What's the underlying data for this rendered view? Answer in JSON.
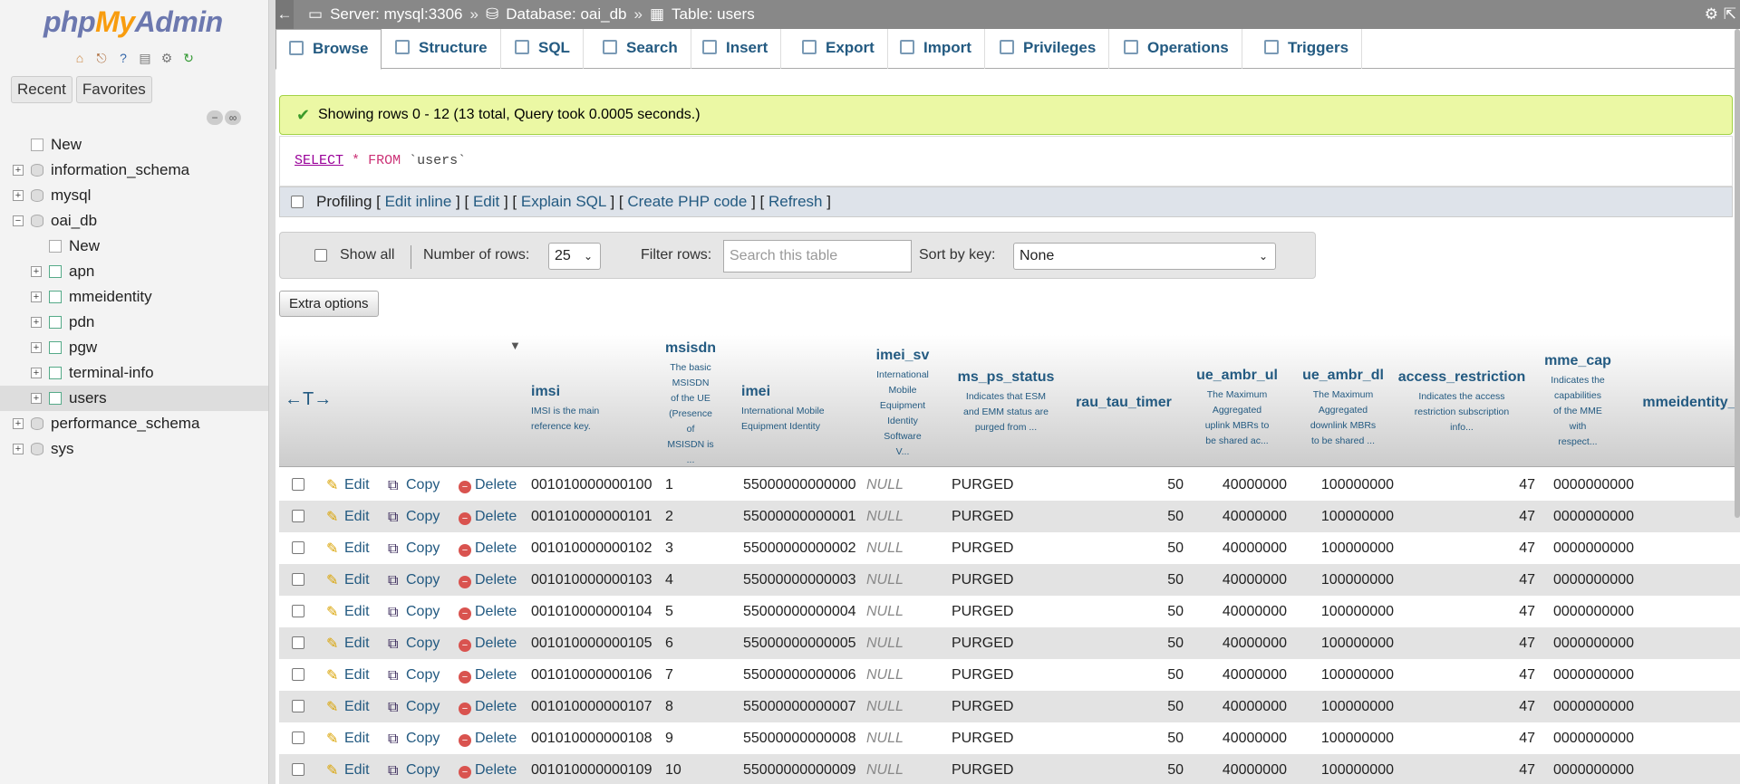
{
  "app": {
    "logo_left": "php",
    "logo_mid": "My",
    "logo_right": "Admin"
  },
  "sidebar": {
    "tabs": [
      "Recent",
      "Favorites"
    ],
    "tree": [
      {
        "label": "New",
        "level": 0,
        "kind": "new"
      },
      {
        "label": "information_schema",
        "level": 0,
        "kind": "db"
      },
      {
        "label": "mysql",
        "level": 0,
        "kind": "db"
      },
      {
        "label": "oai_db",
        "level": 0,
        "kind": "db",
        "expanded": true
      },
      {
        "label": "New",
        "level": 1,
        "kind": "new"
      },
      {
        "label": "apn",
        "level": 1,
        "kind": "tbl"
      },
      {
        "label": "mmeidentity",
        "level": 1,
        "kind": "tbl"
      },
      {
        "label": "pdn",
        "level": 1,
        "kind": "tbl"
      },
      {
        "label": "pgw",
        "level": 1,
        "kind": "tbl"
      },
      {
        "label": "terminal-info",
        "level": 1,
        "kind": "tbl"
      },
      {
        "label": "users",
        "level": 1,
        "kind": "tbl",
        "selected": true
      },
      {
        "label": "performance_schema",
        "level": 0,
        "kind": "db"
      },
      {
        "label": "sys",
        "level": 0,
        "kind": "db"
      }
    ]
  },
  "breadcrumb": {
    "server": "Server: mysql:3306",
    "database": "Database: oai_db",
    "table": "Table: users",
    "sep": "»"
  },
  "tabs": [
    {
      "label": "Browse",
      "active": true
    },
    {
      "label": "Structure"
    },
    {
      "label": "SQL"
    },
    {
      "label": "Search"
    },
    {
      "label": "Insert"
    },
    {
      "label": "Export"
    },
    {
      "label": "Import"
    },
    {
      "label": "Privileges"
    },
    {
      "label": "Operations"
    },
    {
      "label": "Triggers"
    }
  ],
  "success_message": "Showing rows 0 - 12 (13 total, Query took 0.0005 seconds.)",
  "sql": {
    "kw": "SELECT",
    "star": "*",
    "from": "FROM",
    "table": "`users`"
  },
  "profiling": {
    "label": "Profiling",
    "links": [
      "Edit inline",
      "Edit",
      "Explain SQL",
      "Create PHP code",
      "Refresh"
    ]
  },
  "navbar": {
    "show_all": "Show all",
    "rows_label": "Number of rows:",
    "rows_value": "25",
    "filter_label": "Filter rows:",
    "filter_placeholder": "Search this table",
    "sort_label": "Sort by key:",
    "sort_value": "None"
  },
  "extra_options": "Extra options",
  "columns": [
    {
      "name": "imsi",
      "desc": [
        "IMSI is the main",
        "reference key."
      ]
    },
    {
      "name": "msisdn",
      "desc": [
        "The basic",
        "MSISDN",
        "of the UE",
        "(Presence",
        "of",
        "MSISDN is",
        "..."
      ]
    },
    {
      "name": "imei",
      "desc": [
        "International Mobile",
        "Equipment Identity"
      ]
    },
    {
      "name": "imei_sv",
      "desc": [
        "International",
        "Mobile",
        "Equipment",
        "Identity",
        "Software",
        "V..."
      ]
    },
    {
      "name": "ms_ps_status",
      "desc": [
        "Indicates that ESM",
        "and EMM status are",
        "purged from ..."
      ]
    },
    {
      "name": "rau_tau_timer",
      "desc": []
    },
    {
      "name": "ue_ambr_ul",
      "desc": [
        "The Maximum",
        "Aggregated",
        "uplink MBRs to",
        "be shared ac..."
      ]
    },
    {
      "name": "ue_ambr_dl",
      "desc": [
        "The Maximum",
        "Aggregated",
        "downlink MBRs",
        "to be shared ..."
      ]
    },
    {
      "name": "access_restriction",
      "desc": [
        "Indicates the access",
        "restriction subscription",
        "info..."
      ]
    },
    {
      "name": "mme_cap",
      "desc": [
        "Indicates the",
        "capabilities",
        "of the MME",
        "with",
        "respect..."
      ]
    },
    {
      "name": "mmeidentity_",
      "desc": []
    }
  ],
  "actions": {
    "edit": "Edit",
    "copy": "Copy",
    "delete": "Delete"
  },
  "rows": [
    {
      "imsi": "001010000000100",
      "msisdn": "1",
      "imei": "55000000000000",
      "imei_sv": "NULL",
      "ms_ps_status": "PURGED",
      "rau_tau_timer": "50",
      "ue_ambr_ul": "40000000",
      "ue_ambr_dl": "100000000",
      "access_restriction": "47",
      "mme_cap": "0000000000"
    },
    {
      "imsi": "001010000000101",
      "msisdn": "2",
      "imei": "55000000000001",
      "imei_sv": "NULL",
      "ms_ps_status": "PURGED",
      "rau_tau_timer": "50",
      "ue_ambr_ul": "40000000",
      "ue_ambr_dl": "100000000",
      "access_restriction": "47",
      "mme_cap": "0000000000"
    },
    {
      "imsi": "001010000000102",
      "msisdn": "3",
      "imei": "55000000000002",
      "imei_sv": "NULL",
      "ms_ps_status": "PURGED",
      "rau_tau_timer": "50",
      "ue_ambr_ul": "40000000",
      "ue_ambr_dl": "100000000",
      "access_restriction": "47",
      "mme_cap": "0000000000"
    },
    {
      "imsi": "001010000000103",
      "msisdn": "4",
      "imei": "55000000000003",
      "imei_sv": "NULL",
      "ms_ps_status": "PURGED",
      "rau_tau_timer": "50",
      "ue_ambr_ul": "40000000",
      "ue_ambr_dl": "100000000",
      "access_restriction": "47",
      "mme_cap": "0000000000"
    },
    {
      "imsi": "001010000000104",
      "msisdn": "5",
      "imei": "55000000000004",
      "imei_sv": "NULL",
      "ms_ps_status": "PURGED",
      "rau_tau_timer": "50",
      "ue_ambr_ul": "40000000",
      "ue_ambr_dl": "100000000",
      "access_restriction": "47",
      "mme_cap": "0000000000"
    },
    {
      "imsi": "001010000000105",
      "msisdn": "6",
      "imei": "55000000000005",
      "imei_sv": "NULL",
      "ms_ps_status": "PURGED",
      "rau_tau_timer": "50",
      "ue_ambr_ul": "40000000",
      "ue_ambr_dl": "100000000",
      "access_restriction": "47",
      "mme_cap": "0000000000"
    },
    {
      "imsi": "001010000000106",
      "msisdn": "7",
      "imei": "55000000000006",
      "imei_sv": "NULL",
      "ms_ps_status": "PURGED",
      "rau_tau_timer": "50",
      "ue_ambr_ul": "40000000",
      "ue_ambr_dl": "100000000",
      "access_restriction": "47",
      "mme_cap": "0000000000"
    },
    {
      "imsi": "001010000000107",
      "msisdn": "8",
      "imei": "55000000000007",
      "imei_sv": "NULL",
      "ms_ps_status": "PURGED",
      "rau_tau_timer": "50",
      "ue_ambr_ul": "40000000",
      "ue_ambr_dl": "100000000",
      "access_restriction": "47",
      "mme_cap": "0000000000"
    },
    {
      "imsi": "001010000000108",
      "msisdn": "9",
      "imei": "55000000000008",
      "imei_sv": "NULL",
      "ms_ps_status": "PURGED",
      "rau_tau_timer": "50",
      "ue_ambr_ul": "40000000",
      "ue_ambr_dl": "100000000",
      "access_restriction": "47",
      "mme_cap": "0000000000"
    },
    {
      "imsi": "001010000000109",
      "msisdn": "10",
      "imei": "55000000000009",
      "imei_sv": "NULL",
      "ms_ps_status": "PURGED",
      "rau_tau_timer": "50",
      "ue_ambr_ul": "40000000",
      "ue_ambr_dl": "100000000",
      "access_restriction": "47",
      "mme_cap": "0000000000"
    }
  ]
}
